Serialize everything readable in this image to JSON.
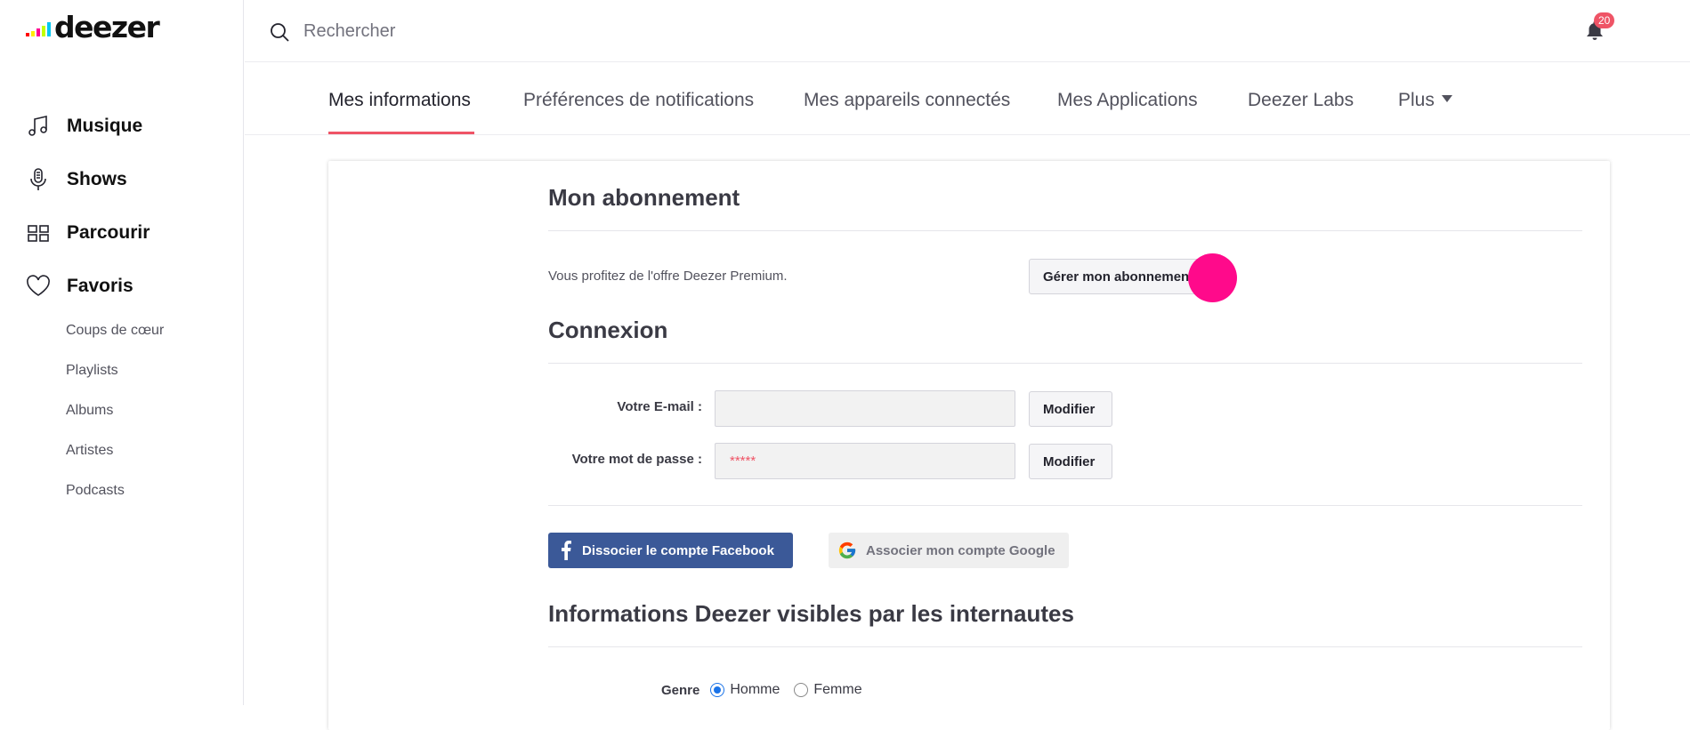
{
  "app": {
    "logo_text": "deezer",
    "logo_colors": [
      "#ff0000",
      "#ffed00",
      "#ff0092",
      "#c2ff00",
      "#00c7f2",
      "#c1f1fc",
      "#ebffac",
      "#ffc1fc"
    ]
  },
  "sidebar": {
    "main_items": [
      {
        "label": "Musique",
        "icon": "music-note-icon"
      },
      {
        "label": "Shows",
        "icon": "microphone-icon"
      },
      {
        "label": "Parcourir",
        "icon": "grid-icon"
      },
      {
        "label": "Favoris",
        "icon": "heart-icon"
      }
    ],
    "sub_items": [
      "Coups de cœur",
      "Playlists",
      "Albums",
      "Artistes",
      "Podcasts"
    ]
  },
  "header": {
    "search_placeholder": "Rechercher",
    "notifications_count": "20"
  },
  "tabs": {
    "items": [
      "Mes informations",
      "Préférences de notifications",
      "Mes appareils connectés",
      "Mes Applications",
      "Deezer Labs",
      "Plus"
    ],
    "active_index": 0,
    "accent_color": "#ef5466"
  },
  "subscription": {
    "title": "Mon abonnement",
    "description": "Vous profitez de l'offre Deezer Premium.",
    "manage_button": "Gérer mon abonnement"
  },
  "connexion": {
    "title": "Connexion",
    "email_label": "Votre E-mail :",
    "email_value": "",
    "password_label": "Votre mot de passe :",
    "password_value": "*****",
    "modify_label": "Modifier",
    "facebook_button": "Dissocier le compte Facebook",
    "google_button": "Associer mon compte Google"
  },
  "public_info": {
    "title": "Informations Deezer visibles par les internautes",
    "gender_label": "Genre",
    "gender_options": [
      "Homme",
      "Femme"
    ],
    "gender_selected": "Homme"
  }
}
